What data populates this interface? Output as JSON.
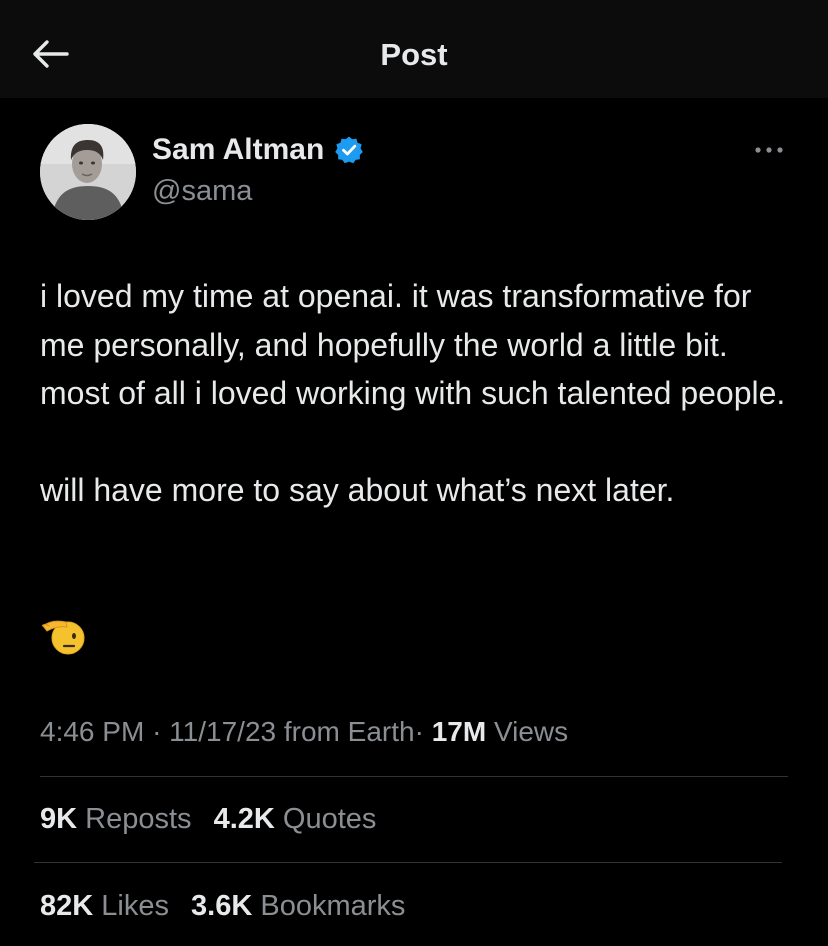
{
  "header": {
    "title": "Post",
    "back_icon": "arrow-left-icon"
  },
  "author": {
    "name": "Sam Altman",
    "handle": "@sama",
    "verified_icon": "verified-badge-icon",
    "verified_color": "#1d9bf0",
    "avatar": "avatar-photo"
  },
  "more_icon": "more-options-icon",
  "post": {
    "paragraph_1": "i loved my time at openai. it was transformative for me personally, and hopefully the world a little bit. most of all i loved working with such talented people.",
    "paragraph_2": "will have more to say about what’s next later.",
    "emoji": "saluting-face-emoji"
  },
  "meta": {
    "time": "4:46 PM",
    "separator": "·",
    "date": "11/17/23",
    "source": "from Earth",
    "views_count": "17M",
    "views_label": "Views"
  },
  "stats": {
    "reposts_count": "9K",
    "reposts_label": "Reposts",
    "quotes_count": "4.2K",
    "quotes_label": "Quotes",
    "likes_count": "82K",
    "likes_label": "Likes",
    "bookmarks_count": "3.6K",
    "bookmarks_label": "Bookmarks"
  },
  "colors": {
    "background": "#000000",
    "header_background": "#0c0c0c",
    "text_primary": "#e7e9ea",
    "text_secondary": "#8b8f93",
    "divider": "#2f3336",
    "accent": "#1d9bf0"
  }
}
